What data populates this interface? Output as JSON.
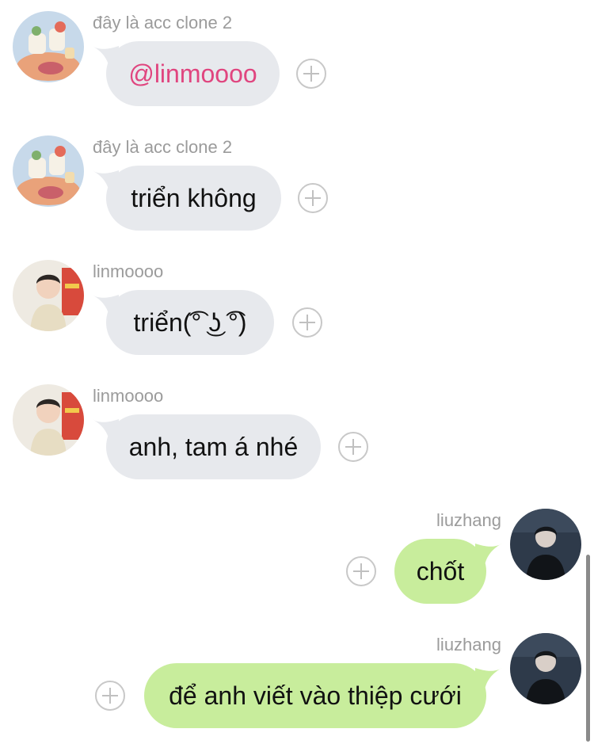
{
  "messages": [
    {
      "sender": "đây là acc clone 2",
      "text": "@linmoooo",
      "direction": "incoming",
      "avatar": "illustration-avatar",
      "is_mention": true
    },
    {
      "sender": "đây là acc clone 2",
      "text": "triển không",
      "direction": "incoming",
      "avatar": "illustration-avatar"
    },
    {
      "sender": "linmoooo",
      "text": "triển(͡° ͜ʖ ͡°)",
      "direction": "incoming",
      "avatar": "person-photo-avatar"
    },
    {
      "sender": "linmoooo",
      "text": "anh, tam á nhé",
      "direction": "incoming",
      "avatar": "person-photo-avatar"
    },
    {
      "sender": "liuzhang",
      "text": "chốt",
      "direction": "outgoing",
      "avatar": "dark-photo-avatar"
    },
    {
      "sender": "liuzhang",
      "text": "để anh viết vào thiệp cưới",
      "direction": "outgoing",
      "avatar": "dark-photo-avatar"
    }
  ],
  "colors": {
    "incoming_bubble": "#e7e9ed",
    "outgoing_bubble": "#c8ed9c",
    "mention": "#e0457f",
    "sender_name": "#9b9b9b"
  },
  "icons": {
    "reaction_button": "add-reaction-icon"
  }
}
